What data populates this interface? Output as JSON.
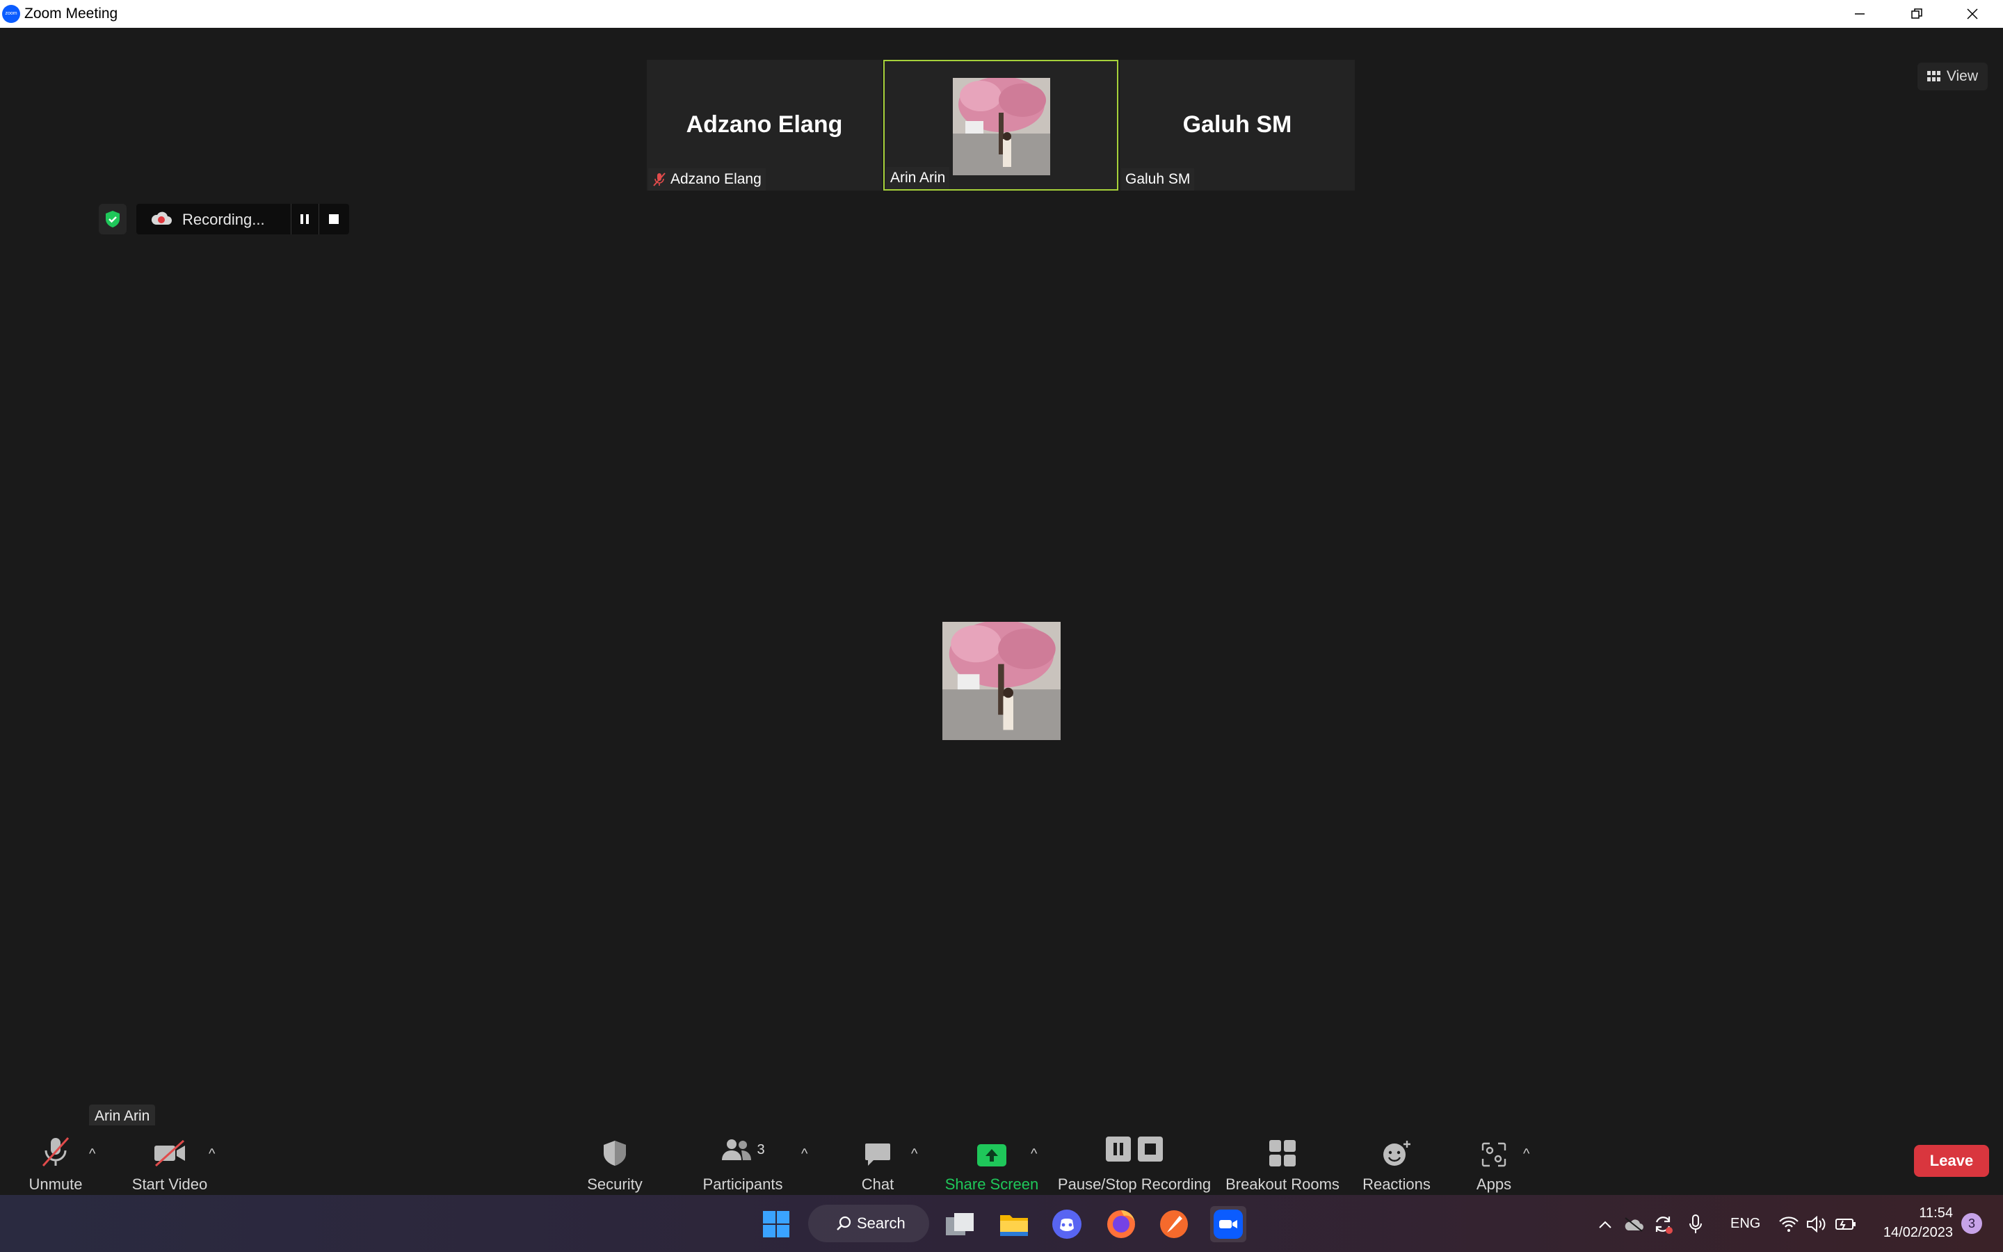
{
  "window": {
    "title": "Zoom Meeting",
    "logo_text": "zoom"
  },
  "top_right": {
    "view_label": "View"
  },
  "participants_strip": [
    {
      "display_name": "Adzano Elang",
      "label": "Adzano Elang",
      "muted": true,
      "video": false,
      "active": false
    },
    {
      "display_name": "",
      "label": "Arin Arin",
      "muted": false,
      "video": true,
      "active": true
    },
    {
      "display_name": "Galuh SM",
      "label": "Galuh SM",
      "muted": false,
      "video": false,
      "active": false
    }
  ],
  "recording": {
    "status_text": "Recording..."
  },
  "self_view": {
    "name_tip": "Arin Arin"
  },
  "toolbar": {
    "unmute": "Unmute",
    "start_video": "Start Video",
    "security": "Security",
    "participants": "Participants",
    "participants_count": "3",
    "chat": "Chat",
    "share_screen": "Share Screen",
    "pause_stop_recording": "Pause/Stop Recording",
    "breakout_rooms": "Breakout Rooms",
    "reactions": "Reactions",
    "apps": "Apps",
    "leave": "Leave"
  },
  "taskbar": {
    "search_label": "Search",
    "language": "ENG",
    "time": "11:54",
    "date": "14/02/2023",
    "notification_count": "3",
    "apps": [
      "windows-start-icon",
      "task-view-icon",
      "file-explorer-icon",
      "discord-icon",
      "firefox-icon",
      "paint-brush-app-icon",
      "zoom-app-icon"
    ]
  },
  "colors": {
    "accent_green": "#1fc75a",
    "leave_red": "#d9363e",
    "active_border": "#a6d13a",
    "zoom_blue": "#0b5cff"
  }
}
